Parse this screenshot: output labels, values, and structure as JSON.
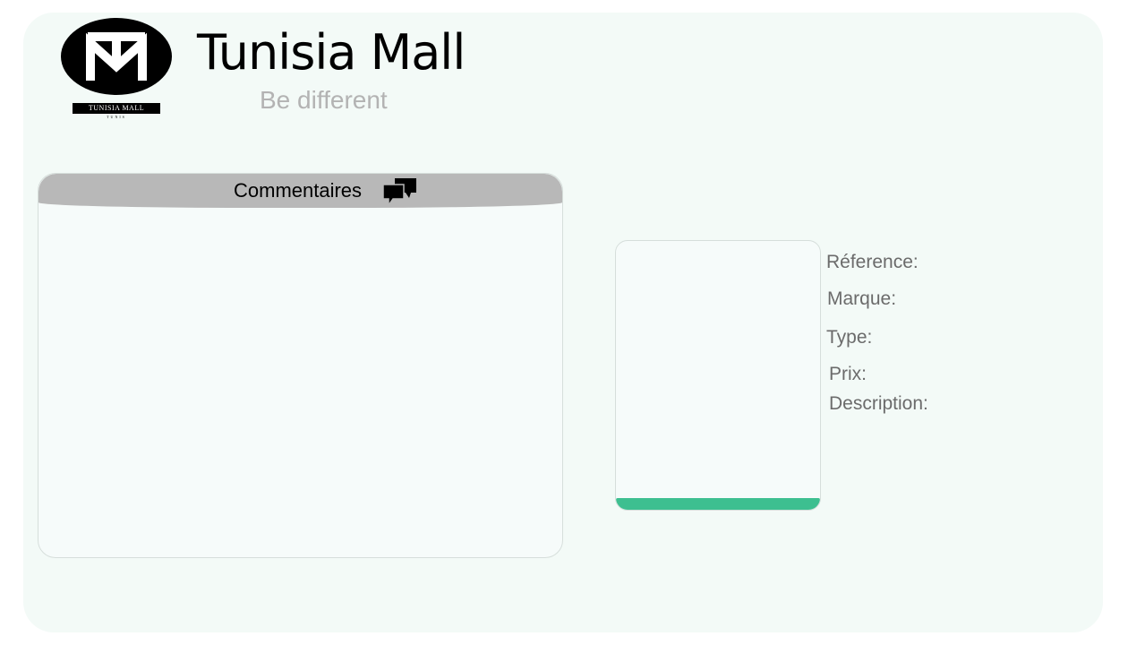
{
  "brand": {
    "title": "Tunisia Mall",
    "slogan": "Be different",
    "logo": {
      "band_text": "TUNISIA MALL",
      "sub_text": "TUNIS",
      "monogram": "TM"
    }
  },
  "comments": {
    "title": "Commentaires",
    "icon": "chat-bubbles-icon"
  },
  "product": {
    "labels": {
      "reference": "Réference:",
      "brand": "Marque:",
      "type": "Type:",
      "price": "Prix:",
      "description": "Description:"
    },
    "image_bar_color": "#3dbf90"
  },
  "colors": {
    "page_background": "#f3faf7",
    "header_bar": "#b8b8b8",
    "accent": "#3dbf90",
    "slogan": "#b3b3b3",
    "label_text": "#6b6b6b"
  }
}
